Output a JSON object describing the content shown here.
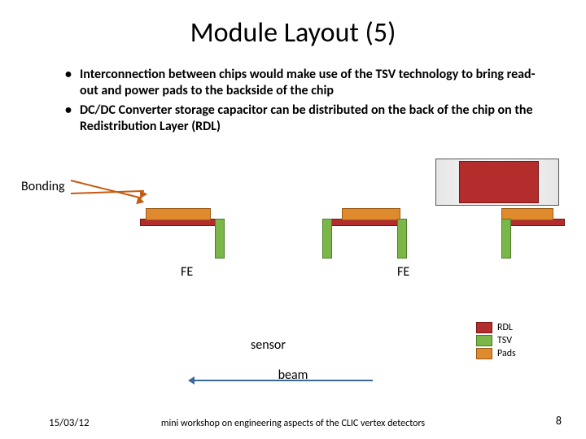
{
  "title": "Module Layout (5)",
  "bullets": [
    "Interconnection between chips would make use of the TSV technology to bring read-out and power pads to the backside of the chip",
    "DC/DC Converter storage capacitor can be distributed on the back of the chip on the Redistribution Layer (RDL)"
  ],
  "labels": {
    "bonding": "Bonding",
    "fe": "FE",
    "sensor": "sensor",
    "beam": "beam"
  },
  "legend": {
    "rdl": "RDL",
    "tsv": "TSV",
    "pads": "Pads"
  },
  "footer": {
    "date": "15/03/12",
    "text": "mini workshop on engineering aspects of the CLIC vertex detectors",
    "page": "8"
  },
  "colors": {
    "rdl": "#b42d2d",
    "tsv": "#7ab648",
    "pads": "#e08a2e",
    "arrow_bonding": "#c55a11",
    "arrow_beam": "#39699b"
  }
}
